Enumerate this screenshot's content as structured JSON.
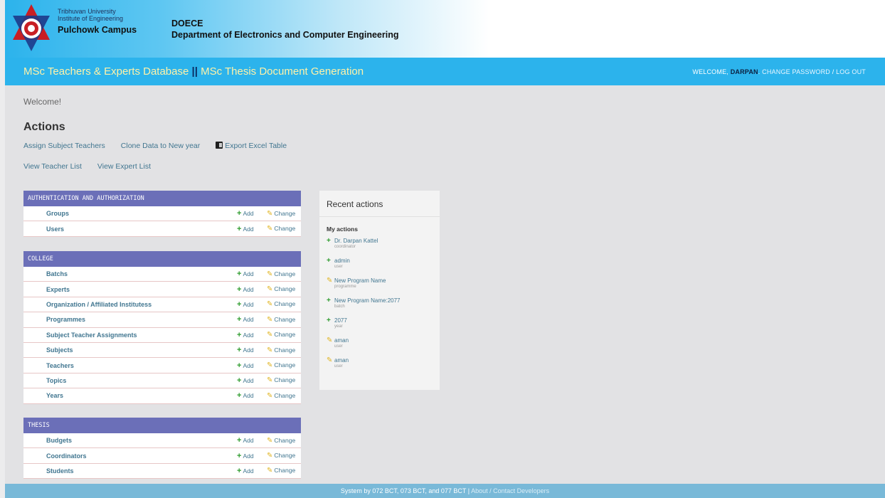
{
  "banner": {
    "university": "Tribhuvan University",
    "institute": "Institute of Engineering",
    "campus": "Pulchowk Campus",
    "dept_abbr": "DOECE",
    "dept_name": "Department of Electronics and Computer Engineering"
  },
  "header": {
    "title_part1": "MSc Teachers & Experts Database",
    "separator": "||",
    "title_part2": "MSc Thesis Document Generation",
    "welcome": "WELCOME,",
    "username": "DARPAN",
    "change_password": "CHANGE PASSWORD",
    "slash": "/",
    "logout": "LOG OUT"
  },
  "main": {
    "welcome": "Welcome!",
    "actions_title": "Actions",
    "actions_row1": [
      "Assign Subject Teachers",
      "Clone Data to New year",
      "Export Excel Table"
    ],
    "actions_row2": [
      "View Teacher List",
      "View Expert List"
    ]
  },
  "labels": {
    "add": "Add",
    "change": "Change"
  },
  "modules": [
    {
      "caption": "Authentication and Authorization",
      "models": [
        "Groups",
        "Users"
      ]
    },
    {
      "caption": "College",
      "models": [
        "Batchs",
        "Experts",
        "Organization / Affiliated Institutess",
        "Programmes",
        "Subject Teacher Assignments",
        "Subjects",
        "Teachers",
        "Topics",
        "Years"
      ]
    },
    {
      "caption": "Thesis",
      "models": [
        "Budgets",
        "Coordinators",
        "Students"
      ]
    }
  ],
  "recent": {
    "title": "Recent actions",
    "my_actions": "My actions",
    "items": [
      {
        "kind": "add",
        "name": "Dr. Darpan Kattel",
        "type": "coordinator"
      },
      {
        "kind": "add",
        "name": "admin",
        "type": "user"
      },
      {
        "kind": "change",
        "name": "New Program Name",
        "type": "programme"
      },
      {
        "kind": "add",
        "name": "New Program Name:2077",
        "type": "batch"
      },
      {
        "kind": "add",
        "name": "2077",
        "type": "year"
      },
      {
        "kind": "change",
        "name": "aman",
        "type": "user"
      },
      {
        "kind": "change",
        "name": "aman",
        "type": "user"
      }
    ]
  },
  "footer": {
    "text": "System by 072 BCT, 073 BCT, and 077 BCT |",
    "link": "About / Contact Developers"
  },
  "colors": {
    "header": "#2cb3ec",
    "module_caption": "#6b6fb8",
    "link": "#417690",
    "add": "#2e9c2e",
    "change": "#e0b420"
  }
}
